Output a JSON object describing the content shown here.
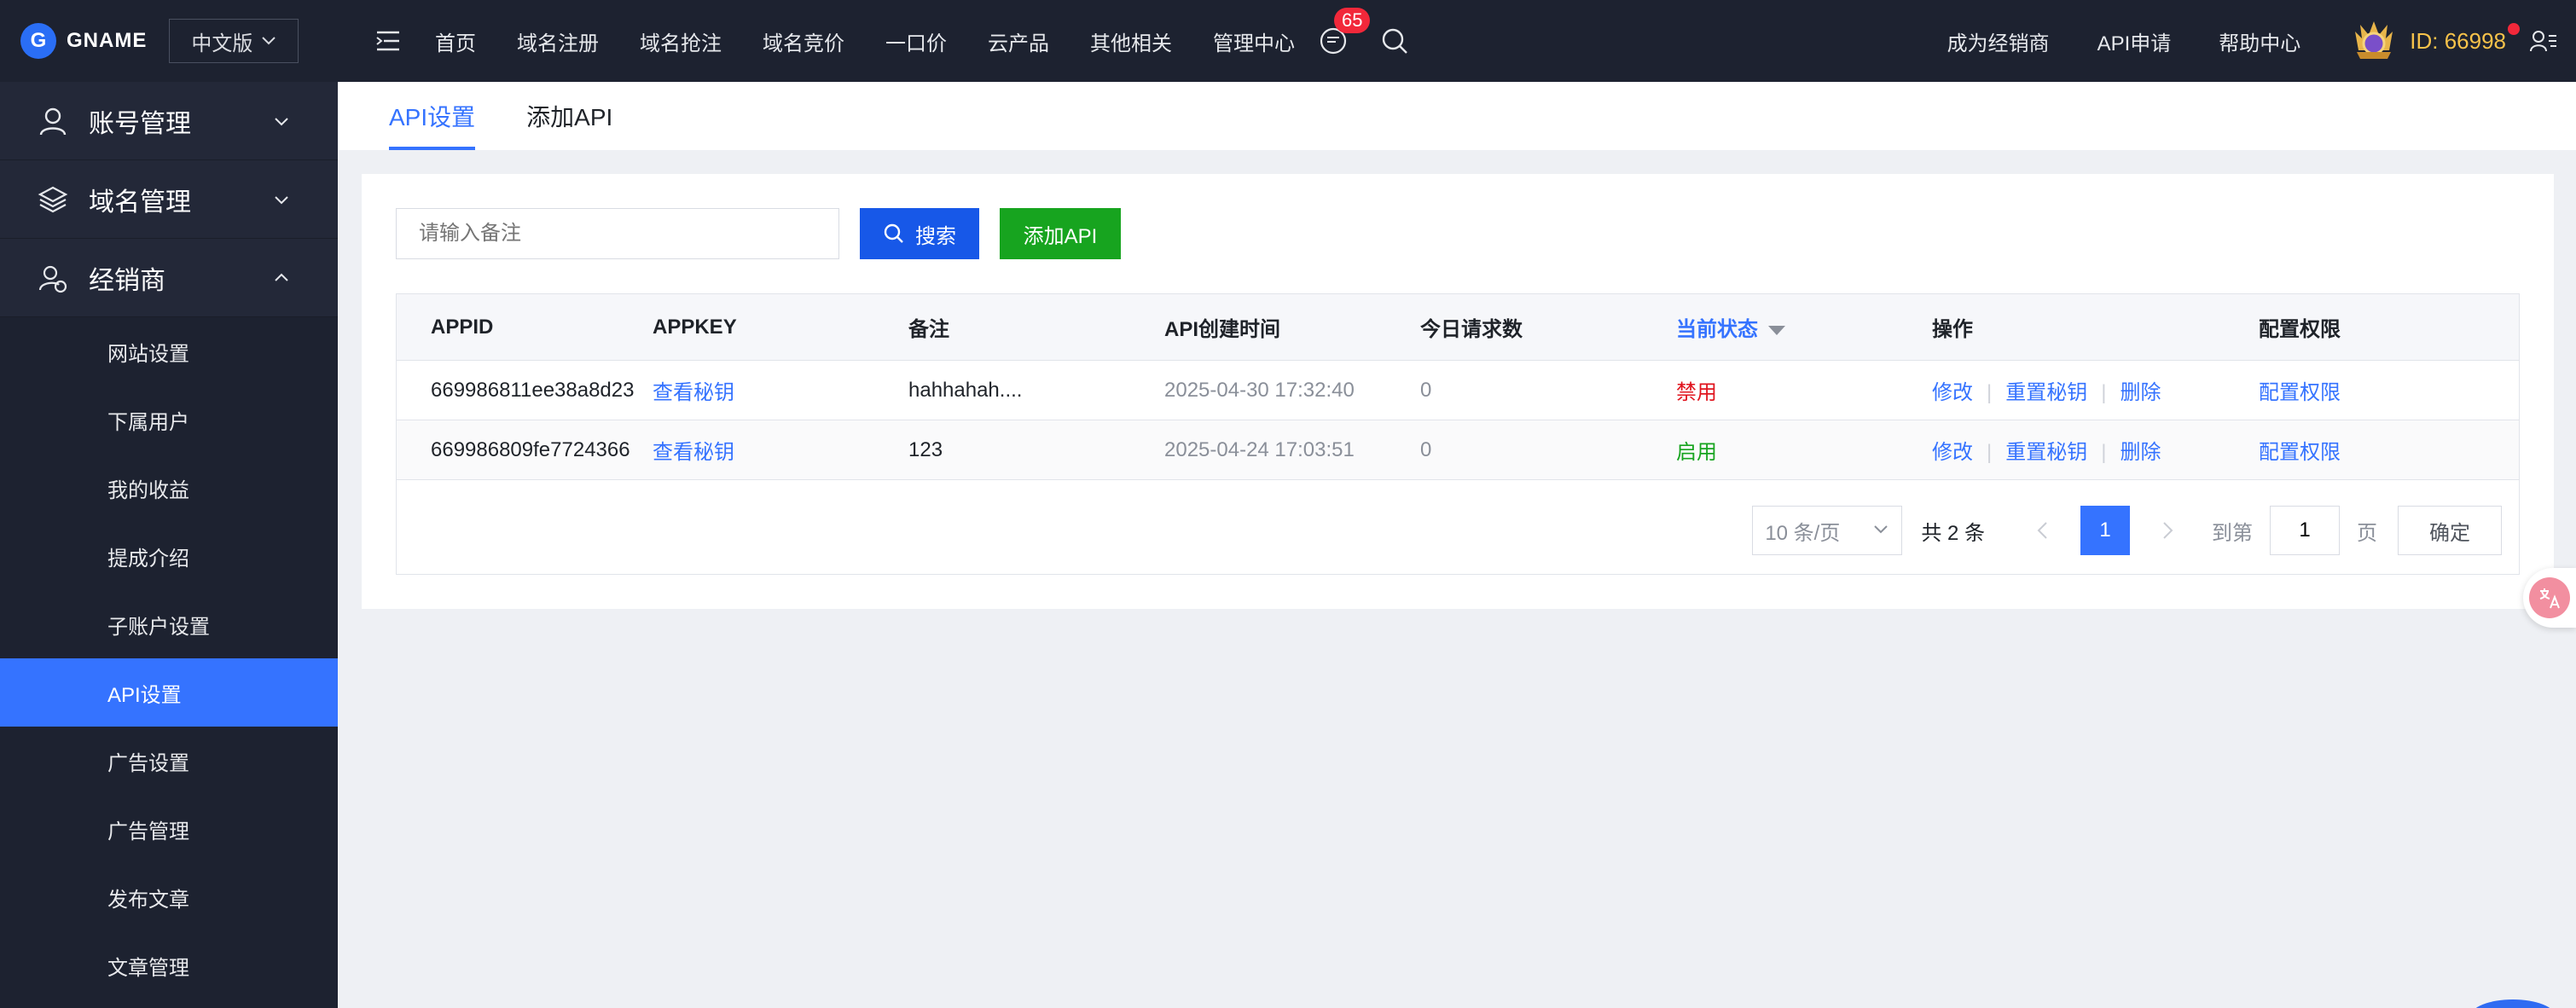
{
  "brand": {
    "logo_letter": "G",
    "name": "GNAME",
    "lang": "中文版"
  },
  "sidebar": {
    "groups": [
      {
        "label": "账号管理",
        "icon": "user-icon",
        "expanded": false
      },
      {
        "label": "域名管理",
        "icon": "layers-icon",
        "expanded": false
      },
      {
        "label": "经销商",
        "icon": "dealer-icon",
        "expanded": true
      }
    ],
    "items": [
      {
        "label": "网站设置"
      },
      {
        "label": "下属用户"
      },
      {
        "label": "我的收益"
      },
      {
        "label": "提成介绍"
      },
      {
        "label": "子账户设置"
      },
      {
        "label": "API设置",
        "active": true
      },
      {
        "label": "广告设置"
      },
      {
        "label": "广告管理"
      },
      {
        "label": "发布文章"
      },
      {
        "label": "文章管理"
      }
    ]
  },
  "topnav": {
    "links": [
      "首页",
      "域名注册",
      "域名抢注",
      "域名竞价",
      "一口价",
      "云产品",
      "其他相关",
      "管理中心"
    ],
    "message_badge": "65",
    "right_links": [
      "成为经销商",
      "API申请",
      "帮助中心"
    ],
    "user_id": "ID: 66998"
  },
  "tabs": [
    {
      "label": "API设置",
      "active": true
    },
    {
      "label": "添加API",
      "active": false
    }
  ],
  "search": {
    "placeholder": "请输入备注",
    "button_label": "搜索",
    "add_button_label": "添加API"
  },
  "table": {
    "headers": [
      "APPID",
      "APPKEY",
      "备注",
      "API创建时间",
      "今日请求数",
      "当前状态",
      "操作",
      "配置权限"
    ],
    "rows": [
      {
        "appid": "669986811ee38a8d23",
        "appkey": "查看秘钥",
        "note": "hahhahah....",
        "created": "2025-04-30 17:32:40",
        "requests": "0",
        "status": "禁用",
        "actions": [
          "修改",
          "重置秘钥",
          "删除"
        ],
        "perm": "配置权限"
      },
      {
        "appid": "669986809fe7724366",
        "appkey": "查看秘钥",
        "note": "123",
        "created": "2025-04-24 17:03:51",
        "requests": "0",
        "status": "启用",
        "actions": [
          "修改",
          "重置秘钥",
          "删除"
        ],
        "perm": "配置权限"
      }
    ]
  },
  "pagination": {
    "page_size": "10 条/页",
    "total": "共 2 条",
    "current_page": "1",
    "goto_label": "到第",
    "goto_value": "1",
    "page_label": "页",
    "confirm_label": "确定"
  },
  "colors": {
    "accent": "#3573ff",
    "sidebar_bg": "#1d2230",
    "disabled_status": "#e0141e",
    "enabled_status": "#17a41f",
    "add_button": "#17a41f"
  }
}
